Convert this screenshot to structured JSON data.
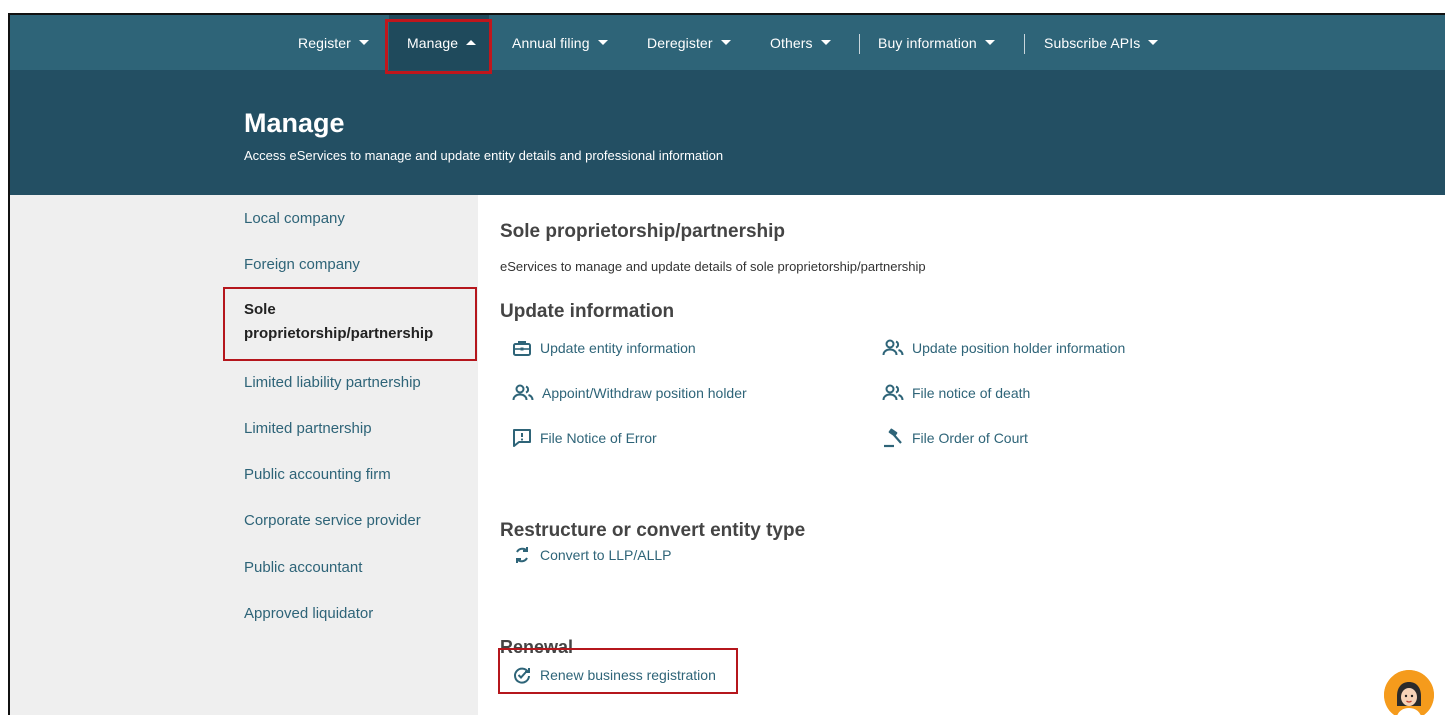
{
  "nav": {
    "items": [
      {
        "label": "Register"
      },
      {
        "label": "Manage"
      },
      {
        "label": "Annual filing"
      },
      {
        "label": "Deregister"
      },
      {
        "label": "Others"
      },
      {
        "label": "Buy information"
      },
      {
        "label": "Subscribe APIs"
      }
    ]
  },
  "hero": {
    "title": "Manage",
    "subtitle": "Access eServices to manage and update entity details and professional information"
  },
  "sidebar": {
    "items": [
      {
        "label": "Local company"
      },
      {
        "label": "Foreign company"
      },
      {
        "label": "Sole proprietorship/partnership"
      },
      {
        "label": "Limited liability partnership"
      },
      {
        "label": "Limited partnership"
      },
      {
        "label": "Public accounting firm"
      },
      {
        "label": "Corporate service provider"
      },
      {
        "label": "Public accountant"
      },
      {
        "label": "Approved liquidator"
      }
    ]
  },
  "main": {
    "title": "Sole proprietorship/partnership",
    "description": "eServices to manage and update details of sole proprietorship/partnership",
    "update": {
      "heading": "Update information",
      "links": [
        {
          "label": "Update entity information",
          "icon": "briefcase-icon"
        },
        {
          "label": "Update position holder information",
          "icon": "users-icon"
        },
        {
          "label": "Appoint/Withdraw position holder",
          "icon": "users-icon"
        },
        {
          "label": "File notice of death",
          "icon": "users-icon"
        },
        {
          "label": "File Notice of Error",
          "icon": "alert-message-icon"
        },
        {
          "label": "File Order of Court",
          "icon": "gavel-icon"
        }
      ]
    },
    "restructure": {
      "heading": "Restructure or convert entity type",
      "links": [
        {
          "label": "Convert to LLP/ALLP",
          "icon": "sync-icon"
        }
      ]
    },
    "renewal": {
      "heading": "Renewal",
      "links": [
        {
          "label": "Renew business registration",
          "icon": "renew-check-icon"
        }
      ]
    }
  },
  "colors": {
    "nav_bg": "#2e6478",
    "hero_bg": "#234f63",
    "link": "#2e6478",
    "highlight": "#b5161c",
    "chat": "#f59b1c"
  }
}
